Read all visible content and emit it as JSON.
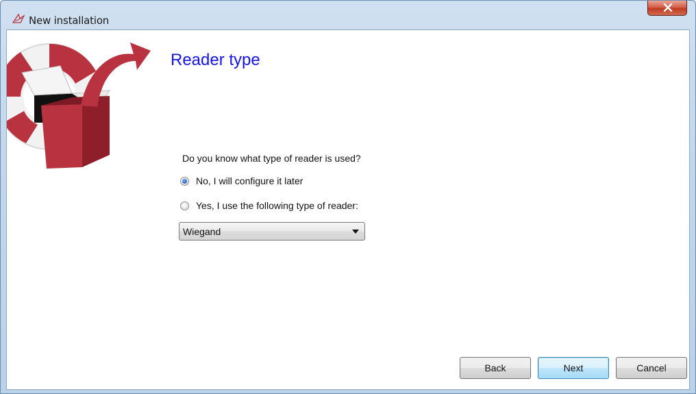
{
  "window": {
    "title": "New installation"
  },
  "page": {
    "heading": "Reader type",
    "question": "Do you know what type of reader is used?",
    "options": [
      {
        "label": "No, I will configure it later",
        "checked": true
      },
      {
        "label": "Yes, I use the following type of reader:",
        "checked": false
      }
    ],
    "reader_select": {
      "value": "Wiegand"
    }
  },
  "buttons": {
    "back": "Back",
    "next": "Next",
    "cancel": "Cancel"
  },
  "icons": {
    "app": "wizard-app-icon",
    "close": "close-icon",
    "logo": "open-box-lifebuoy-arrow-logo"
  },
  "colors": {
    "heading": "#1414e8",
    "logo_red": "#b8323f",
    "close_button": "#c13b22"
  }
}
